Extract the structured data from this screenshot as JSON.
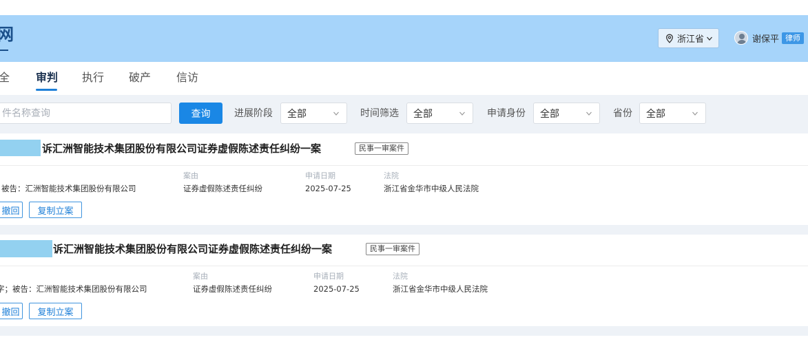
{
  "header": {
    "logo_text": "网",
    "region": {
      "label": "浙江省",
      "icon": "location-pin-icon"
    },
    "user": {
      "name": "谢保平",
      "role_badge": "律师"
    },
    "colors": {
      "header_bg": "#a6d4fa",
      "accent": "#1a87e5"
    }
  },
  "tabs": [
    {
      "label": "全",
      "active": false
    },
    {
      "label": "审判",
      "active": true
    },
    {
      "label": "执行",
      "active": false
    },
    {
      "label": "破产",
      "active": false
    },
    {
      "label": "信访",
      "active": false
    }
  ],
  "filters": {
    "search_placeholder": "件名称查询",
    "query_label": "查询",
    "items": [
      {
        "label": "进展阶段",
        "value": "全部"
      },
      {
        "label": "时间筛选",
        "value": "全部"
      },
      {
        "label": "申请身份",
        "value": "全部"
      },
      {
        "label": "省份",
        "value": "全部"
      }
    ]
  },
  "cases": [
    {
      "title": "诉汇洲智能技术集团股份有限公司证券虚假陈述责任纠纷一案",
      "tag": "民事一审案件",
      "parties": "被告：汇洲智能技术集团股份有限公司",
      "cause_label": "案由",
      "cause": "证券虚假陈述责任纠纷",
      "date_label": "申请日期",
      "date": "2025-07-25",
      "court_label": "法院",
      "court": "浙江省金华市中级人民法院",
      "actions": [
        "撤回",
        "复制立案"
      ]
    },
    {
      "title": "诉汇洲智能技术集团股份有限公司证券虚假陈述责任纠纷一案",
      "tag": "民事一审案件",
      "parties": "字；被告：汇洲智能技术集团股份有限公司",
      "cause_label": "案由",
      "cause": "证券虚假陈述责任纠纷",
      "date_label": "申请日期",
      "date": "2025-07-25",
      "court_label": "法院",
      "court": "浙江省金华市中级人民法院",
      "actions": [
        "撤回",
        "复制立案"
      ]
    }
  ]
}
